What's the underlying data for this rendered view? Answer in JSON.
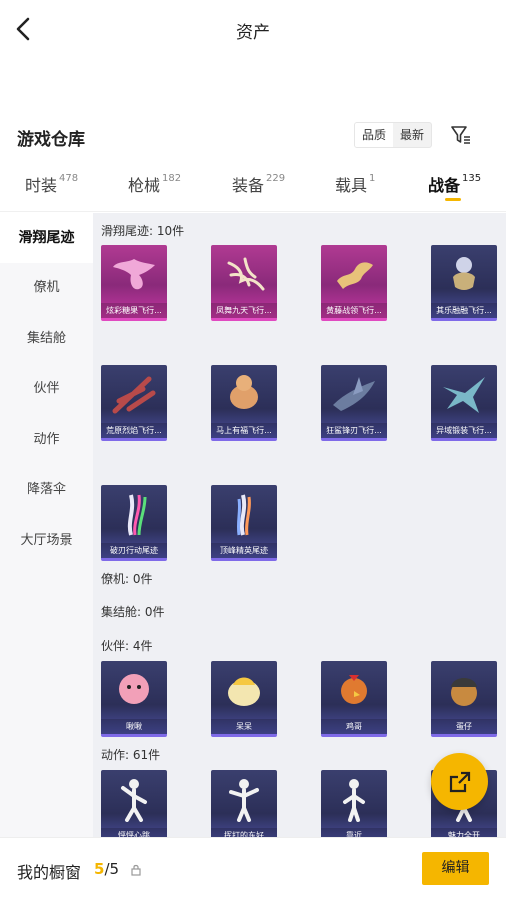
{
  "header": {
    "title": "资产"
  },
  "warehouse": {
    "title": "游戏仓库",
    "sort": [
      "品质",
      "最新"
    ]
  },
  "tabs": [
    {
      "label": "时装",
      "count": "478"
    },
    {
      "label": "枪械",
      "count": "182"
    },
    {
      "label": "装备",
      "count": "229"
    },
    {
      "label": "载具",
      "count": "1"
    },
    {
      "label": "战备",
      "count": "135"
    }
  ],
  "sidebar": [
    "滑翔尾迹",
    "僚机",
    "集结舱",
    "伙伴",
    "动作",
    "降落伞",
    "大厅场景"
  ],
  "sections": {
    "glide": "滑翔尾迹: 10件",
    "wingman": "僚机: 0件",
    "pod": "集结舱: 0件",
    "partner": "伙伴: 4件",
    "emote": "动作: 61件"
  },
  "glide_items": [
    "炫彩糖果飞行...",
    "凤舞九天飞行...",
    "黄藤战领飞行...",
    "其乐融融飞行...",
    "荒原烈焰飞行...",
    "马上有福飞行...",
    "狂鲨锋刃飞行...",
    "异域锻装飞行...",
    "破刃行动尾迹",
    "顶峰精英尾迹"
  ],
  "partner_items": [
    "啾啾",
    "呆呆",
    "鸡哥",
    "蛋仔"
  ],
  "emote_items": [
    "怦怦心跳",
    "挥打的东好",
    "靠近",
    "魅力全开"
  ],
  "bottom": {
    "label": "我的橱窗",
    "count_cur": "5",
    "count_sep": "/",
    "count_total": "5",
    "edit": "编辑"
  },
  "colors": {
    "accent": "#f5b600"
  }
}
